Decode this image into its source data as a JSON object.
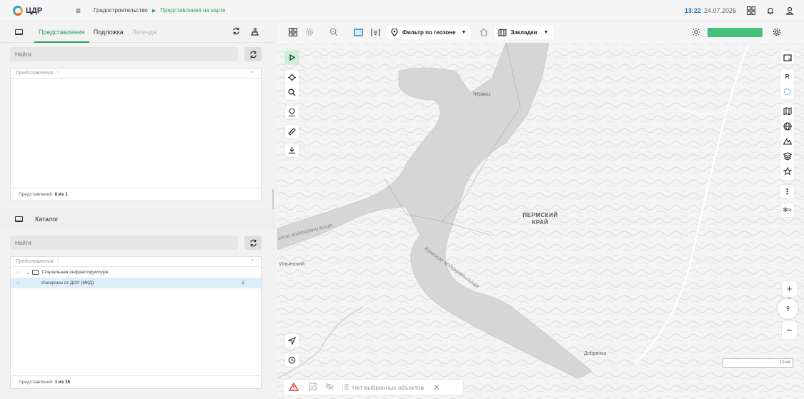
{
  "header": {
    "logo_text": "ЦДР",
    "breadcrumb": [
      "Градостроительство",
      "Представления на карте"
    ],
    "time": "13:22",
    "date": "24.07.2026"
  },
  "left_panel": {
    "tabs": [
      {
        "label": "Представления",
        "state": "active"
      },
      {
        "label": "Подложка",
        "state": "normal"
      },
      {
        "label": "Легенда",
        "state": "disabled"
      }
    ],
    "views": {
      "search_placeholder": "Найти",
      "column_header": "Представления",
      "footer_label": "Представлений:",
      "footer_value": "0 из 1"
    },
    "catalog": {
      "title": "Каталог",
      "search_placeholder": "Найти",
      "column_header": "Представления",
      "rows": [
        {
          "label": "Социальная инфраструктура",
          "type": "folder",
          "count": ""
        },
        {
          "label": "Изохроны от ДОУ (МКД)",
          "type": "item",
          "count": "2",
          "selected": true
        }
      ],
      "footer_label": "Представлений:",
      "footer_value": "1 из 35"
    }
  },
  "map": {
    "toolbar": {
      "filter_label": "Фильтр по геозоне",
      "bookmarks_label": "Закладки",
      "status_color": "#43c07c"
    },
    "labels": {
      "chermoz": "Чёрмоз",
      "region": "ПЕРМСКИЙ КРАЙ",
      "reservoir_left": "ское водохранилище",
      "reservoir_right": "Камское водохранилище",
      "ilinsky": "Ильинский",
      "dobryanka": "Добрянка"
    },
    "scale_label": "10 км",
    "zoom_level": "9",
    "right_tool_r": "R",
    "bottom_bar_text": "Нет выбранных объектов"
  },
  "colors": {
    "accent": "#2f9f5f",
    "water": "#d4d4d4",
    "selected_row": "#dbeefa",
    "warning": "#e23b3b"
  }
}
